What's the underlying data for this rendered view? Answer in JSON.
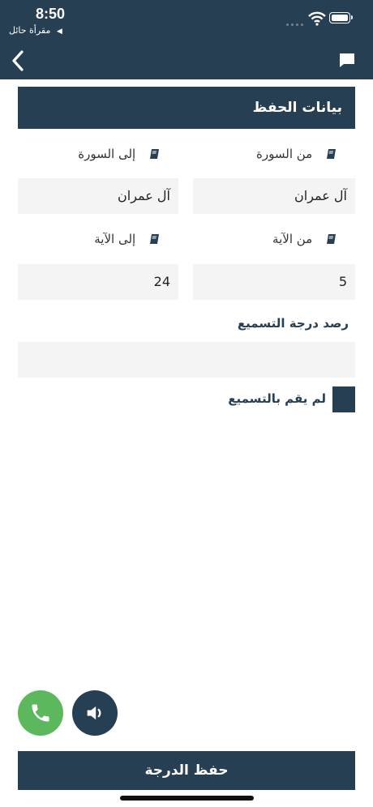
{
  "status": {
    "time": "8:50",
    "back_app": "مقرأة حائل",
    "back_arrow": "◀"
  },
  "header": {
    "back_icon": "chevron-left-icon",
    "chat_icon": "chat-bubble-icon"
  },
  "section": {
    "title": "بيانات الحفظ"
  },
  "fields": {
    "from_surah_label": "من السورة",
    "to_surah_label": "إلى السورة",
    "from_surah_value": "آل عمران",
    "to_surah_value": "آل عمران",
    "from_ayah_label": "من الآية",
    "to_ayah_label": "إلى الآية",
    "from_ayah_value": "5",
    "to_ayah_value": "24"
  },
  "grade": {
    "label": "رصد درجة التسميع",
    "value": ""
  },
  "checkbox": {
    "label": "لم يقم بالتسميع",
    "checked": false
  },
  "actions": {
    "save_label": "حفظ الدرجة",
    "call_icon": "phone-icon",
    "sound_icon": "speaker-icon"
  },
  "colors": {
    "primary": "#263f53",
    "call": "#5cb85c",
    "field_bg": "#f4f4f4"
  }
}
